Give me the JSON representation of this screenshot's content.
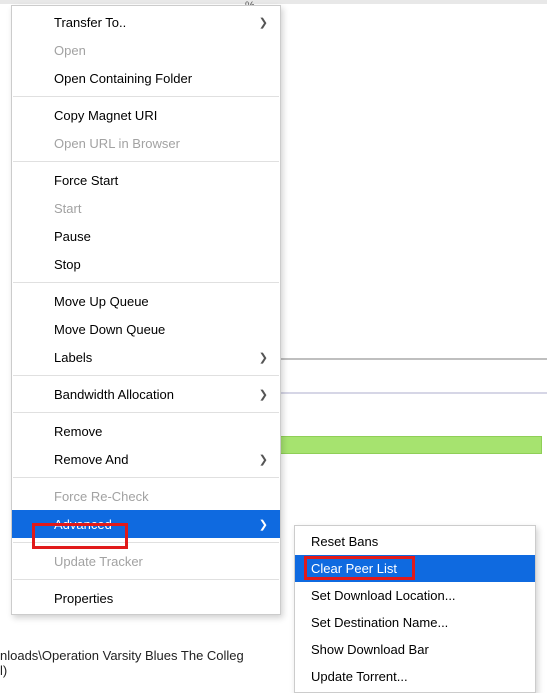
{
  "background": {
    "percent_label": "%",
    "footer_path": "nloads\\Operation Varsity Blues The Colleg",
    "footer_tail": "l)"
  },
  "menu": {
    "transfer_to": "Transfer To..",
    "open": "Open",
    "open_containing": "Open Containing Folder",
    "copy_magnet": "Copy Magnet URI",
    "open_url": "Open URL in Browser",
    "force_start": "Force Start",
    "start": "Start",
    "pause": "Pause",
    "stop": "Stop",
    "move_up": "Move Up Queue",
    "move_down": "Move Down Queue",
    "labels": "Labels",
    "bandwidth": "Bandwidth Allocation",
    "remove": "Remove",
    "remove_and": "Remove And",
    "force_recheck": "Force Re-Check",
    "advanced": "Advanced",
    "update_tracker": "Update Tracker",
    "properties": "Properties"
  },
  "submenu": {
    "reset_bans": "Reset Bans",
    "clear_peer": "Clear Peer List",
    "set_dl_location": "Set Download Location...",
    "set_dest_name": "Set Destination Name...",
    "show_dl_bar": "Show Download Bar",
    "update_torrent": "Update Torrent..."
  }
}
